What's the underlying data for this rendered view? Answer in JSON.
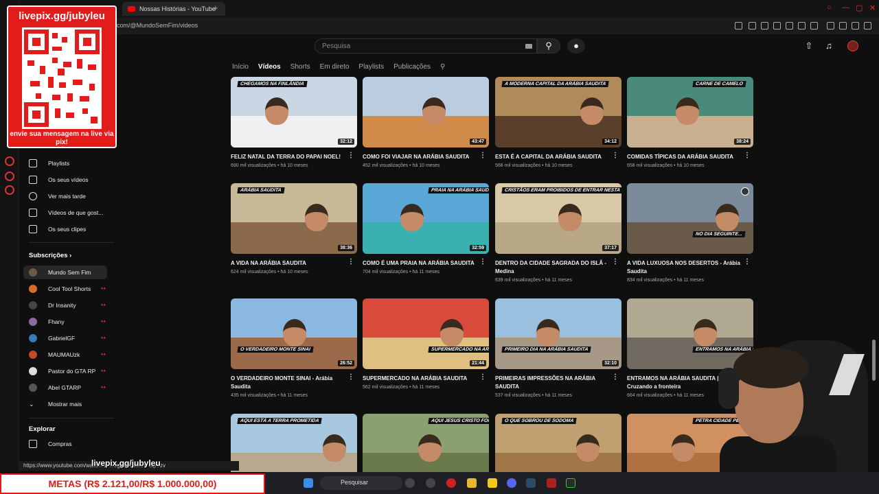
{
  "browser": {
    "tab_title": "Nossas Histórias - YouTube",
    "url": "com/@MundoSemFim/videos",
    "status_url": "https://www.youtube.com/watch?v=...0gcJCQMKAYcqIYzv"
  },
  "header": {
    "search_placeholder": "Pesquisa"
  },
  "channel_tabs": [
    "Início",
    "Vídeos",
    "Shorts",
    "Em direto",
    "Playlists",
    "Publicações"
  ],
  "sidebar": {
    "items": [
      {
        "label": "Playlists"
      },
      {
        "label": "Os seus vídeos"
      },
      {
        "label": "Ver mais tarde"
      },
      {
        "label": "Vídeos de que gost..."
      },
      {
        "label": "Os seus clipes"
      }
    ],
    "subscriptions_heading": "Subscrições",
    "subscriptions": [
      {
        "label": "Mundo Sem Fim",
        "color": "#6b5b4b"
      },
      {
        "label": "Cool Tool Shorts",
        "color": "#d86a2a"
      },
      {
        "label": "Dr Insanity",
        "color": "#444444"
      },
      {
        "label": "Fhany",
        "color": "#8a6a9a"
      },
      {
        "label": "GabrielGF",
        "color": "#3a7ab8"
      },
      {
        "label": "MAUMAUzk",
        "color": "#c04a2a"
      },
      {
        "label": "Pastor do GTA RP",
        "color": "#dddddd"
      },
      {
        "label": "Abel GTARP",
        "color": "#555555"
      }
    ],
    "show_more": "Mostrar mais",
    "explore_heading": "Explorar",
    "explore": [
      {
        "label": "Compras"
      }
    ]
  },
  "overlay": {
    "qr_title": "livepix.gg/jubyleu",
    "qr_caption": "envie sua mensagem na live via pix!",
    "bottom_handle": "livepix.gg/jubyleu",
    "metas": "METAS (R$ 2.121,00/R$ 1.000.000,00)"
  },
  "taskbar": {
    "search": "Pesquisar"
  },
  "videos": [
    {
      "title": "FELIZ NATAL DA TERRA DO PAPAI NOEL!",
      "meta": "690 mil visualizações • há 10 meses",
      "duration": "32:12",
      "caption": "CHEGAMOS NA FINLÂNDIA",
      "sky": "#c9d6e3",
      "ground": "#f0f0f2"
    },
    {
      "title": "COMO FOI VIAJAR NA ARÁBIA SAUDITA",
      "meta": "452 mil visualizações • há 10 meses",
      "duration": "43:47",
      "caption": "",
      "sky": "#b9cce0",
      "ground": "#d08a4a"
    },
    {
      "title": "ESTA É A CAPITAL DA ARÁBIA SAUDITA",
      "meta": "568 mil visualizações • há 10 meses",
      "duration": "34:12",
      "caption": "A MODERNA CAPITAL DA ARÁBIA SAUDITA",
      "sky": "#b08a5a",
      "ground": "#5a3f2a"
    },
    {
      "title": "COMIDAS TÍPICAS DA ARÁBIA SAUDITA",
      "meta": "658 mil visualizações • há 10 meses",
      "duration": "38:24",
      "caption": "CARNE DE CAMELO",
      "sky": "#4a8a7a",
      "ground": "#c8b090"
    },
    {
      "title": "A VIDA NA ARÁBIA SAUDITA",
      "meta": "624 mil visualizações • há 10 meses",
      "duration": "38:36",
      "caption": "ARÁBIA SAUDITA",
      "sky": "#c8b898",
      "ground": "#8a6a4a"
    },
    {
      "title": "COMO É UMA PRAIA NA ARÁBIA SAUDITA",
      "meta": "704 mil visualizações • há 11 meses",
      "duration": "32:59",
      "caption": "PRAIA NA ARÁBIA SAUDITA",
      "sky": "#5aa8d8",
      "ground": "#3ab0b0"
    },
    {
      "title": "DENTRO DA CIDADE SAGRADA DO ISLÃ - Medina",
      "meta": "639 mil visualizações • há 11 meses",
      "duration": "37:17",
      "caption": "CRISTÃOS ERAM PROIBIDOS DE ENTRAR NESTA CIDADE",
      "sky": "#d8c8a8",
      "ground": "#b8a888"
    },
    {
      "title": "A VIDA LUXUOSA NOS DESERTOS - Arábia Saudita",
      "meta": "834 mil visualizações • há 11 meses",
      "duration": "",
      "caption": "NO DIA SEGUINTE...",
      "sky": "#7a8a9a",
      "ground": "#6a5a4a"
    },
    {
      "title": "O VERDADEIRO MONTE SINAI - Arábia Saudita",
      "meta": "435 mil visualizações • há 11 meses",
      "duration": "26:52",
      "caption": "O VERDADEIRO MONTE SINAI",
      "sky": "#8ab8e0",
      "ground": "#9a6a4a"
    },
    {
      "title": "SUPERMERCADO NA ARÁBIA SAUDITA",
      "meta": "562 mil visualizações • há 11 meses",
      "duration": "21:44",
      "caption": "SUPERMERCADO NA ARÁBIA SAUDITA",
      "sky": "#d84a3a",
      "ground": "#e0c080"
    },
    {
      "title": "PRIMEIRAS IMPRESSÕES NA ARÁBIA SAUDITA",
      "meta": "537 mil visualizações • há 11 meses",
      "duration": "32:10",
      "caption": "PRIMEIRO DIA NA ARÁBIA SAUDITA",
      "sky": "#9ac0e0",
      "ground": "#a89888"
    },
    {
      "title": "ENTRAMOS NA ARÁBIA SAUDITA | Cruzando a fronteira",
      "meta": "664 mil visualizações • há 11 meses",
      "duration": "",
      "caption": "ENTRAMOS NA ARÁBIA SAUDITA",
      "sky": "#b0a890",
      "ground": "#706a60"
    },
    {
      "title": "",
      "meta": "",
      "duration": "",
      "caption": "AQUI ESTÁ A TERRA PROMETIDA",
      "sky": "#a8c8e0",
      "ground": "#b8a890"
    },
    {
      "title": "",
      "meta": "",
      "duration": "",
      "caption": "AQUI JESUS CRISTO FOI BATIZADO",
      "sky": "#8aa070",
      "ground": "#6a7a4a"
    },
    {
      "title": "",
      "meta": "",
      "duration": "",
      "caption": "O QUE SOBROU DE SODOMA",
      "sky": "#c0a070",
      "ground": "#a07848"
    },
    {
      "title": "",
      "meta": "",
      "duration": "",
      "caption": "PETRA CIDADE PERDIDA",
      "sky": "#d09060",
      "ground": "#b07040"
    }
  ]
}
